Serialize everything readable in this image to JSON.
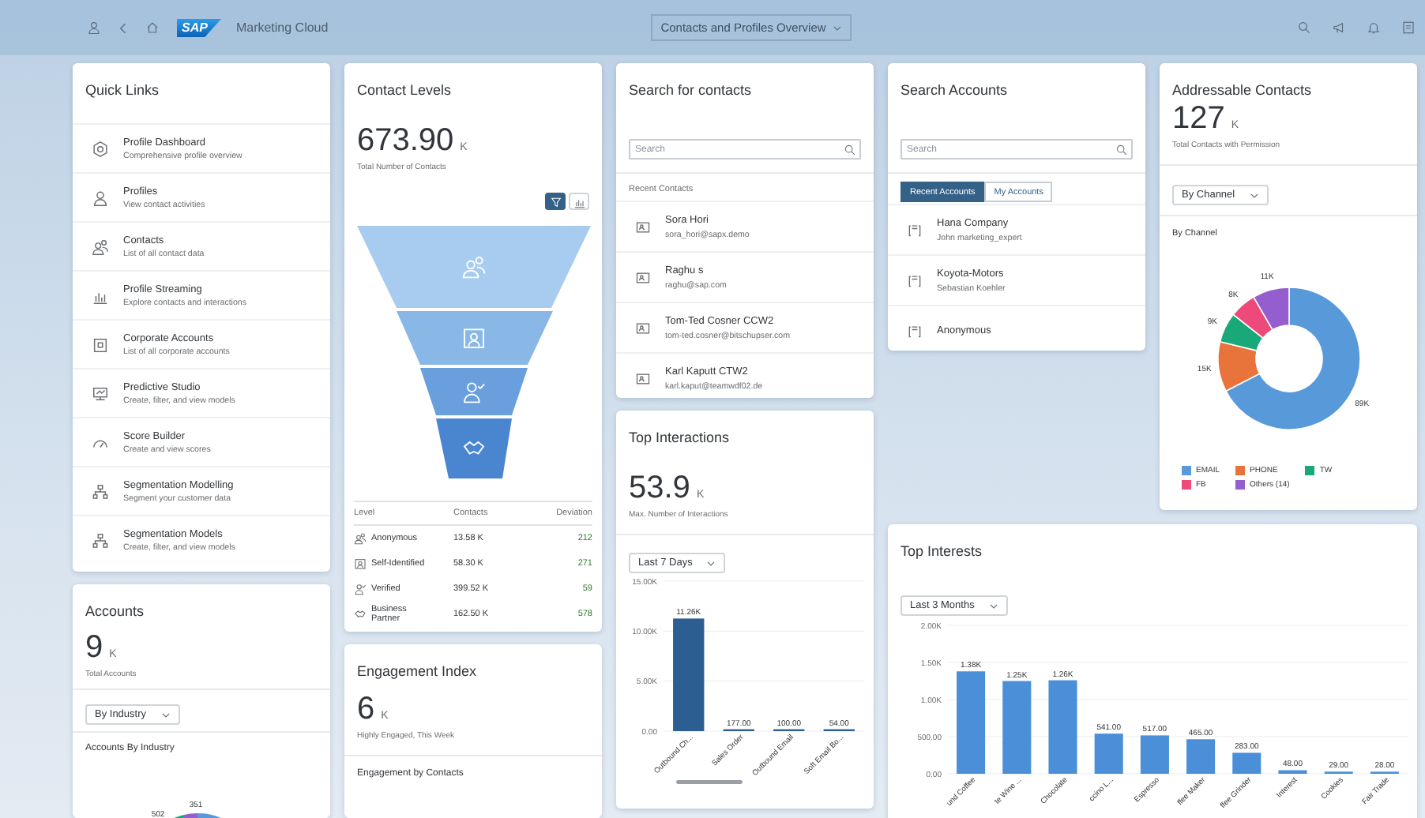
{
  "header": {
    "logo": "SAP",
    "app_title": "Marketing Cloud",
    "page_title": "Contacts and Profiles Overview"
  },
  "quick_links": {
    "title": "Quick Links",
    "items": [
      {
        "title": "Profile Dashboard",
        "subtitle": "Comprehensive profile overview"
      },
      {
        "title": "Profiles",
        "subtitle": "View contact activities"
      },
      {
        "title": "Contacts",
        "subtitle": "List of all contact data"
      },
      {
        "title": "Profile Streaming",
        "subtitle": "Explore contacts and interactions"
      },
      {
        "title": "Corporate Accounts",
        "subtitle": "List of all corporate accounts"
      },
      {
        "title": "Predictive Studio",
        "subtitle": "Create, filter, and view models"
      },
      {
        "title": "Score Builder",
        "subtitle": "Create and view scores"
      },
      {
        "title": "Segmentation Modelling",
        "subtitle": "Segment your customer data"
      },
      {
        "title": "Segmentation Models",
        "subtitle": "Create, filter, and view models"
      }
    ]
  },
  "accounts": {
    "title": "Accounts",
    "value": "9",
    "unit": "K",
    "caption": "Total Accounts",
    "filter": "By Industry",
    "chart_title": "Accounts By Industry",
    "chart_labels": [
      "502",
      "351"
    ]
  },
  "contact_levels": {
    "title": "Contact Levels",
    "value": "673.90",
    "unit": "K",
    "caption": "Total Number of Contacts",
    "view_toggle": [
      {
        "kind": "funnel",
        "selected": true
      },
      {
        "kind": "bars",
        "selected": false
      }
    ],
    "table": {
      "columns": [
        "Level",
        "Contacts",
        "Deviation"
      ],
      "rows": [
        {
          "level": "Anonymous",
          "contacts": "13.58 K",
          "deviation": "212"
        },
        {
          "level": "Self-Identified",
          "contacts": "58.30 K",
          "deviation": "271"
        },
        {
          "level": "Verified",
          "contacts": "399.52 K",
          "deviation": "59"
        },
        {
          "level": "Business Partner",
          "contacts": "162.50 K",
          "deviation": "578"
        }
      ]
    }
  },
  "engagement": {
    "title": "Engagement Index",
    "value": "6",
    "unit": "K",
    "caption": "Highly Engaged, This Week",
    "chart_title": "Engagement by Contacts"
  },
  "search_contacts": {
    "title": "Search for contacts",
    "search": {
      "placeholder": "Search"
    },
    "section": "Recent Contacts",
    "contacts": [
      {
        "name": "Sora Hori",
        "email": "sora_hori@sapx.demo"
      },
      {
        "name": "Raghu s",
        "email": "raghu@sap.com"
      },
      {
        "name": "Tom-Ted Cosner CCW2",
        "email": "tom-ted.cosner@bitschupser.com"
      },
      {
        "name": "Karl Kaputt CTW2",
        "email": "karl.kaput@teamwdf02.de"
      }
    ]
  },
  "top_interactions": {
    "title": "Top Interactions",
    "value": "53.9",
    "unit": "K",
    "caption": "Max. Number of Interactions",
    "filter": "Last 7 Days",
    "chart_data": {
      "type": "bar",
      "categories": [
        "Outbound Ch...",
        "Sales Order",
        "Outbound Email",
        "Soft Email Bo..."
      ],
      "series": [
        {
          "color": "#2d5e91",
          "values": [
            11260,
            177,
            100,
            54
          ]
        }
      ],
      "grid": true,
      "ylim": [
        0,
        15000
      ],
      "yticks": [
        {
          "value": 0,
          "label": "0.00"
        },
        {
          "value": 5000,
          "label": "5.00K"
        },
        {
          "value": 10000,
          "label": "10.00K"
        },
        {
          "value": 15000,
          "label": "15.00K"
        }
      ],
      "value_labels": [
        "11.26K",
        "177.00",
        "100.00",
        "54.00"
      ]
    }
  },
  "search_accounts": {
    "title": "Search Accounts",
    "search": {
      "placeholder": "Search"
    },
    "tabs": [
      {
        "label": "Recent Accounts",
        "selected": true
      },
      {
        "label": "My Accounts",
        "selected": false
      }
    ],
    "accounts": [
      {
        "name": "Hana Company",
        "contact": "John marketing_expert"
      },
      {
        "name": "Koyota-Motors",
        "contact": "Sebastian Koehler"
      },
      {
        "name": "Anonymous"
      }
    ]
  },
  "addressable": {
    "title": "Addressable Contacts",
    "value": "127",
    "unit": "K",
    "caption": "Total Contacts with Permission",
    "filter": "By Channel",
    "chart_title": "By Channel",
    "chart_data": {
      "type": "donut",
      "categories": [
        "EMAIL",
        "PHONE",
        "TW",
        "FB",
        "Others (14)"
      ],
      "values": [
        89,
        15,
        9,
        8,
        11
      ],
      "value_labels": [
        "89K",
        "15K",
        "9K",
        "8K",
        "11K"
      ]
    },
    "legend": [
      {
        "color": "#5899da"
      },
      {
        "color": "#e8743b"
      },
      {
        "color": "#19a979"
      },
      {
        "color": "#ed4a7b"
      },
      {
        "color": "#945ecf"
      }
    ]
  },
  "top_interests": {
    "title": "Top Interests",
    "filter": "Last 3 Months",
    "chart_data": {
      "type": "bar",
      "categories": [
        "und Coffee",
        "te Wine ...",
        "Chocolate",
        "ccino L...",
        "Espresso",
        "ffee Maker",
        "ffee Grinder",
        "Interest",
        "Cookies",
        "Fair Trade"
      ],
      "series": [
        {
          "color": "#4a8fd8",
          "values": [
            1380,
            1250,
            1260,
            541,
            517,
            465,
            283,
            48,
            29,
            28
          ]
        }
      ],
      "grid": true,
      "ylim": [
        0,
        2000
      ],
      "yticks": [
        {
          "value": 0,
          "label": "0.00"
        },
        {
          "value": 500,
          "label": "500.00"
        },
        {
          "value": 1000,
          "label": "1.00K"
        },
        {
          "value": 1500,
          "label": "1.50K"
        },
        {
          "value": 2000,
          "label": "2.00K"
        }
      ],
      "value_labels": [
        "1.38K",
        "1.25K",
        "1.26K",
        "541.00",
        "517.00",
        "465.00",
        "283.00",
        "48.00",
        "29.00",
        "28.00"
      ]
    }
  }
}
